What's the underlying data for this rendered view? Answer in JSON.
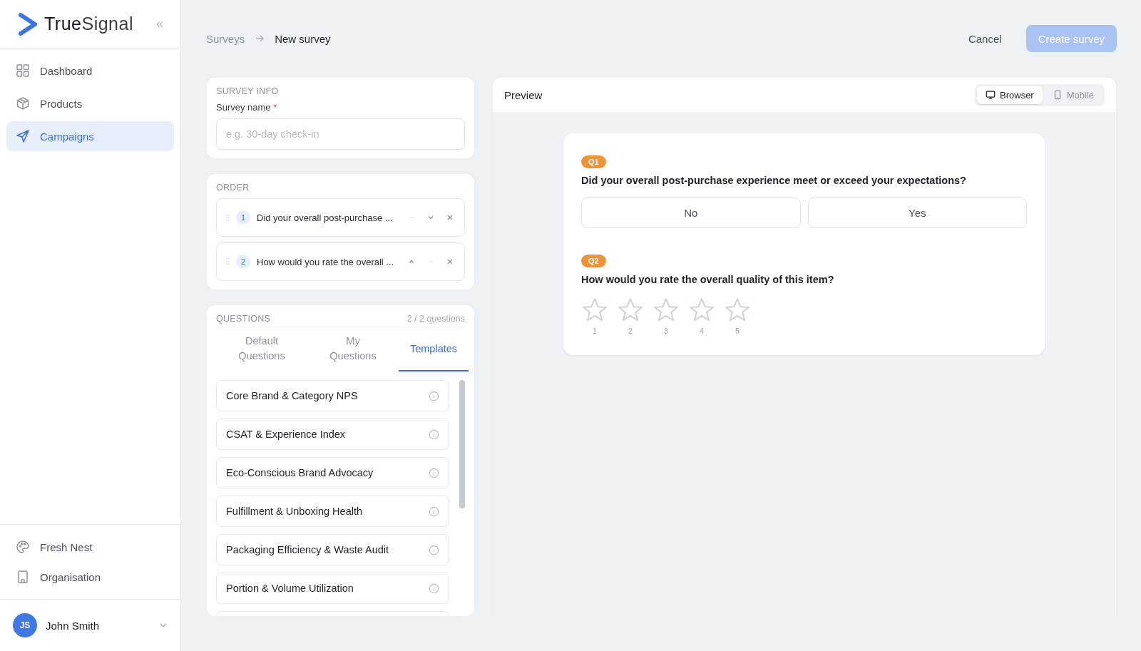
{
  "sidebar": {
    "logo": {
      "first": "True",
      "second": "Signal"
    },
    "collapse_icon": "«",
    "nav": [
      {
        "label": "Dashboard",
        "selected": false
      },
      {
        "label": "Products",
        "selected": false
      },
      {
        "label": "Campaigns",
        "selected": true
      }
    ],
    "bottom": [
      {
        "label": "Fresh Nest"
      },
      {
        "label": "Organisation"
      }
    ],
    "user": {
      "initials": "JS",
      "name": "John Smith"
    }
  },
  "breadcrumb": [
    "Surveys",
    "New survey"
  ],
  "actions": {
    "cancel": "Cancel",
    "create": {
      "label": "Create survey",
      "disabled": true
    }
  },
  "survey_info": {
    "heading": "SURVEY INFO",
    "label": "Survey name",
    "required_mark": "*",
    "placeholder": "e.g. 30-day check-in"
  },
  "order": {
    "heading": "ORDER",
    "items": [
      {
        "number": "1",
        "text": "Did your overall post-purchase ...",
        "up_enabled": false,
        "down_enabled": true
      },
      {
        "number": "2",
        "text": "How would you rate the overall ...",
        "up_enabled": true,
        "down_enabled": false
      }
    ]
  },
  "questions": {
    "heading": "QUESTIONS",
    "count": "2 / 2 questions",
    "tabs": [
      {
        "label": "Default Questions",
        "selected": false
      },
      {
        "label": "My Questions",
        "selected": false
      },
      {
        "label": "Templates",
        "selected": true
      }
    ],
    "templates": [
      "Core Brand & Category NPS",
      "CSAT & Experience Index",
      "Eco-Conscious Brand Advocacy",
      "Fulfillment & Unboxing Health",
      "Packaging Efficiency & Waste Audit",
      "Portion & Volume Utilization"
    ]
  },
  "preview": {
    "title": "Preview",
    "modes": [
      {
        "label": "Browser",
        "selected": true
      },
      {
        "label": "Mobile",
        "selected": false
      }
    ],
    "questions": [
      {
        "kind": "choice",
        "badge": "Q1",
        "text": "Did your overall post-purchase experience meet or exceed your expectations?",
        "options": [
          "No",
          "Yes"
        ]
      },
      {
        "kind": "rating",
        "badge": "Q2",
        "text": "How would you rate the overall quality of this item?",
        "stars": 0,
        "scale": [
          "1",
          "2",
          "3",
          "4",
          "5"
        ]
      }
    ]
  }
}
